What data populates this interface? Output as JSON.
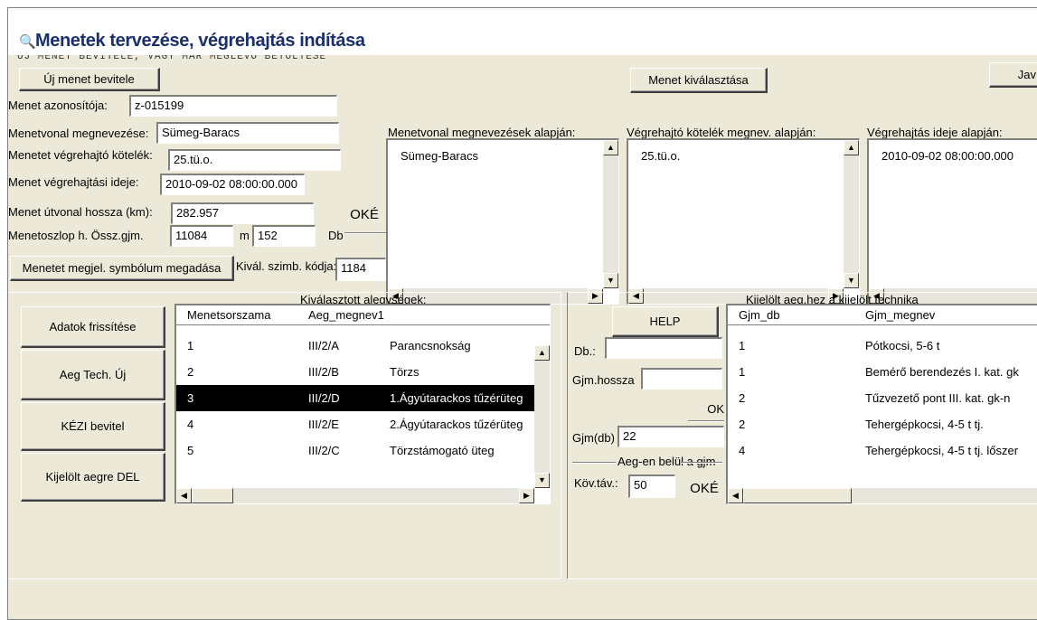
{
  "window": {
    "title": "Menetek tervezése, végrehajtás indítása",
    "subtitle": "ÚJ MENET BEVITELE, VAGY MÁR MEGLÉVŐ BETÖLTÉSE"
  },
  "top_buttons": {
    "new_menet": "Új menet bevitele",
    "select_menet": "Menet kiválasztása",
    "jav": "Jav"
  },
  "form": {
    "id_label": "Menet azonosítója:",
    "id_value": "z-015199",
    "route_label": "Menetvonal megnevezése:",
    "route_value": "Sümeg-Baracs",
    "unit_label": "Menetet végrehajtó kötelék:",
    "unit_value": "25.tü.o.",
    "time_label": "Menet végrehajtási ideje:",
    "time_value": "2010-09-02 08:00:00.000",
    "length_label": "Menet útvonal hossza (km):",
    "length_value": "282.957",
    "column_label": "Menetoszlop h. Össz.gjm.",
    "column_value": "11084",
    "column_unit": "m",
    "count_value": "152",
    "count_unit": "Db",
    "ok_label": "OKÉ",
    "symbol_button": "Menetet megjel. symbólum megadása",
    "symbol_code_label": "Kivál. szimb. kódja:",
    "symbol_code_value": "1184"
  },
  "lists": [
    {
      "header": "Menetvonal megnevezések alapján:",
      "item": "Sümeg-Baracs"
    },
    {
      "header": "Végrehajtó kötelék megnev. alapján:",
      "item": "25.tü.o."
    },
    {
      "header": "Végrehajtás ideje alapján:",
      "item": "2010-09-02 08:00:00.000"
    }
  ],
  "left_buttons": {
    "refresh": "Adatok frissítése",
    "aeg_tech_new": "Aeg Tech. Új",
    "manual": "KÉZI bevitel",
    "delete": "Kijelölt aegre  DEL"
  },
  "units_grid": {
    "caption": "Kiválasztott alegységek:",
    "columns": [
      "Menetsorszama",
      "Aeg_megnev1"
    ],
    "rows": [
      {
        "num": "1",
        "code": "III/2/A",
        "name": "Parancsnokság"
      },
      {
        "num": "2",
        "code": "III/2/B",
        "name": "Törzs"
      },
      {
        "num": "3",
        "code": "III/2/D",
        "name": "1.Ágyútarackos tűzérüteg"
      },
      {
        "num": "4",
        "code": "III/2/E",
        "name": "2.Ágyútarackos tűzérüteg"
      },
      {
        "num": "5",
        "code": "III/2/C",
        "name": "Törzstámogató üteg"
      }
    ],
    "selected_index": 2
  },
  "middle": {
    "help": "HELP",
    "db_label": "Db.:",
    "db_value": "",
    "len_label": "Gjm.hossza",
    "len_value": "",
    "ok": "OK",
    "gjm_db_label": "Gjm(db)",
    "gjm_db_value": "22",
    "inner_label": "Aeg-en belül a  gjm",
    "distance_label": "Köv.táv.:",
    "distance_value": "50",
    "oke": "OKÉ"
  },
  "tech_grid": {
    "caption": "Kijelölt aeg.hez a kijelölt technika",
    "columns": [
      "Gjm_db",
      "Gjm_megnev"
    ],
    "rows": [
      {
        "count": "1",
        "name": "Pótkocsi, 5-6 t"
      },
      {
        "count": "1",
        "name": "Bemérő berendezés I. kat. gk"
      },
      {
        "count": "2",
        "name": "Tűzvezető pont III. kat. gk-n"
      },
      {
        "count": "2",
        "name": "Tehergépkocsi, 4-5 t tj."
      },
      {
        "count": "4",
        "name": "Tehergépkocsi, 4-5 t tj. lőszer"
      }
    ]
  },
  "colors": {
    "face": "#ece9d8",
    "title": "#1b2f6e",
    "selection": "#000000"
  }
}
